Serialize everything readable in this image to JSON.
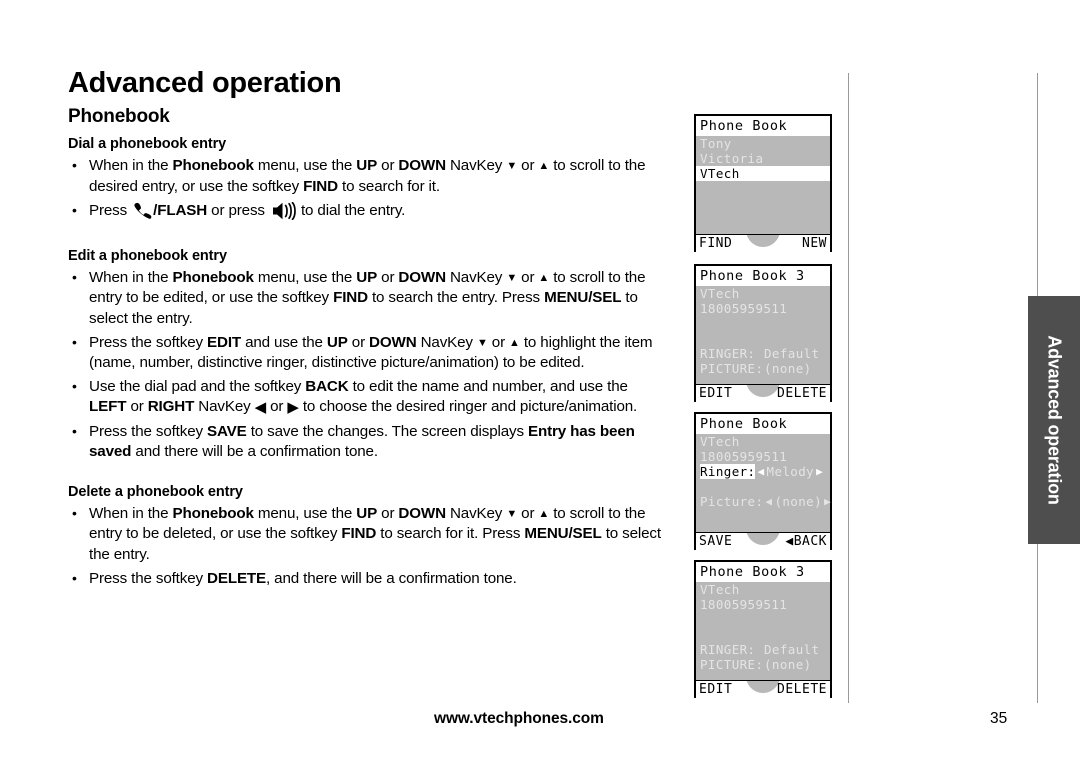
{
  "chapter_title": "Advanced operation",
  "section_title": "Phonebook",
  "subsections": {
    "dial": "Dial a phonebook entry",
    "edit": "Edit a phonebook entry",
    "delete": "Delete a phonebook entry"
  },
  "side_tab": {
    "label": "Advanced operation",
    "color": "#4e4e4e"
  },
  "footer": {
    "website": "www.vtechphones.com",
    "page_number": "35"
  },
  "icons": {
    "navkey_down": "▼",
    "navkey_up": "▲",
    "navkey_left": "◀",
    "navkey_right": "▶",
    "phone_flash": "phone-handset-icon",
    "speaker": "speakerphone-icon"
  },
  "bullets": {
    "dial_1_a": "When in the ",
    "dial_1_b": "Phonebook",
    "dial_1_c": " menu, use the ",
    "dial_1_d": "UP",
    "dial_1_e": " or ",
    "dial_1_f": "DOWN",
    "dial_1_g": " NavKey ",
    "dial_1_h": " or ",
    "dial_1_i": " to scroll to the desired entry, or use the softkey ",
    "dial_1_j": "FIND",
    "dial_1_k": " to search for it.",
    "dial_2_a": "Press ",
    "dial_2_b": "/FLASH",
    "dial_2_c": " or press ",
    "dial_2_d": " to dial the entry.",
    "edit_1_a": "When in the ",
    "edit_1_b": "Phonebook",
    "edit_1_c": " menu, use the ",
    "edit_1_d": "UP",
    "edit_1_e": " or ",
    "edit_1_f": "DOWN",
    "edit_1_g": " NavKey ",
    "edit_1_h": " or ",
    "edit_1_i": " to scroll to the entry to be edited, or use the softkey ",
    "edit_1_j": "FIND",
    "edit_1_k": " to search the entry. Press ",
    "edit_1_l": "MENU/SEL",
    "edit_1_m": " to select the entry.",
    "edit_2_a": "Press the softkey ",
    "edit_2_b": "EDIT",
    "edit_2_c": " and use the ",
    "edit_2_d": "UP",
    "edit_2_e": " or ",
    "edit_2_f": "DOWN",
    "edit_2_g": " NavKey ",
    "edit_2_h": " or ",
    "edit_2_i": " to highlight the item (name, number, distinctive ringer, distinctive picture/animation) to be edited.",
    "edit_3_a": "Use the dial pad and the softkey ",
    "edit_3_b": "BACK",
    "edit_3_c": " to edit the name and number, and use the ",
    "edit_3_d": "LEFT",
    "edit_3_e": " or ",
    "edit_3_f": "RIGHT",
    "edit_3_g": " NavKey ",
    "edit_3_h": " or ",
    "edit_3_i": " to choose the desired ringer and picture/animation.",
    "edit_4_a": "Press the softkey ",
    "edit_4_b": "SAVE",
    "edit_4_c": " to save the changes. The screen displays ",
    "edit_4_d": "Entry has been saved",
    "edit_4_e": " and there will be a confirmation tone.",
    "del_1_a": "When in the ",
    "del_1_b": "Phonebook",
    "del_1_c": " menu, use the ",
    "del_1_d": "UP",
    "del_1_e": " or ",
    "del_1_f": "DOWN",
    "del_1_g": " NavKey ",
    "del_1_h": " or ",
    "del_1_i": " to scroll to the entry to be deleted, or use the softkey ",
    "del_1_j": "FIND",
    "del_1_k": " to search for it. Press ",
    "del_1_l": "MENU/SEL",
    "del_1_m": " to select the entry.",
    "del_2_a": "Press the softkey ",
    "del_2_b": "DELETE",
    "del_2_c": ", and there will be a confirmation tone."
  },
  "screens": [
    {
      "title": "Phone Book",
      "entries": [
        "Tony",
        "Victoria",
        "VTech"
      ],
      "highlighted": "VTech",
      "softkey_left": "FIND",
      "softkey_right": "NEW"
    },
    {
      "title": "Phone Book 3",
      "name": "VTech",
      "number": "18005959511",
      "ringer_label": "RINGER:",
      "ringer_value": "Default",
      "picture_label": "PICTURE:",
      "picture_value": "(none)",
      "softkey_left": "EDIT",
      "softkey_right": "DELETE"
    },
    {
      "title": "Phone Book",
      "name": "VTech",
      "number": "18005959511",
      "ringer_label": "Ringer:",
      "ringer_value": "Melody",
      "picture_label": "Picture:",
      "picture_value": "(none)",
      "softkey_left": "SAVE",
      "softkey_right": "BACK"
    },
    {
      "title": "Phone Book 3",
      "name": "VTech",
      "number": "18005959511",
      "ringer_label": "RINGER:",
      "ringer_value": "Default",
      "picture_label": "PICTURE:",
      "picture_value": "(none)",
      "softkey_left": "EDIT",
      "softkey_right": "DELETE"
    }
  ]
}
